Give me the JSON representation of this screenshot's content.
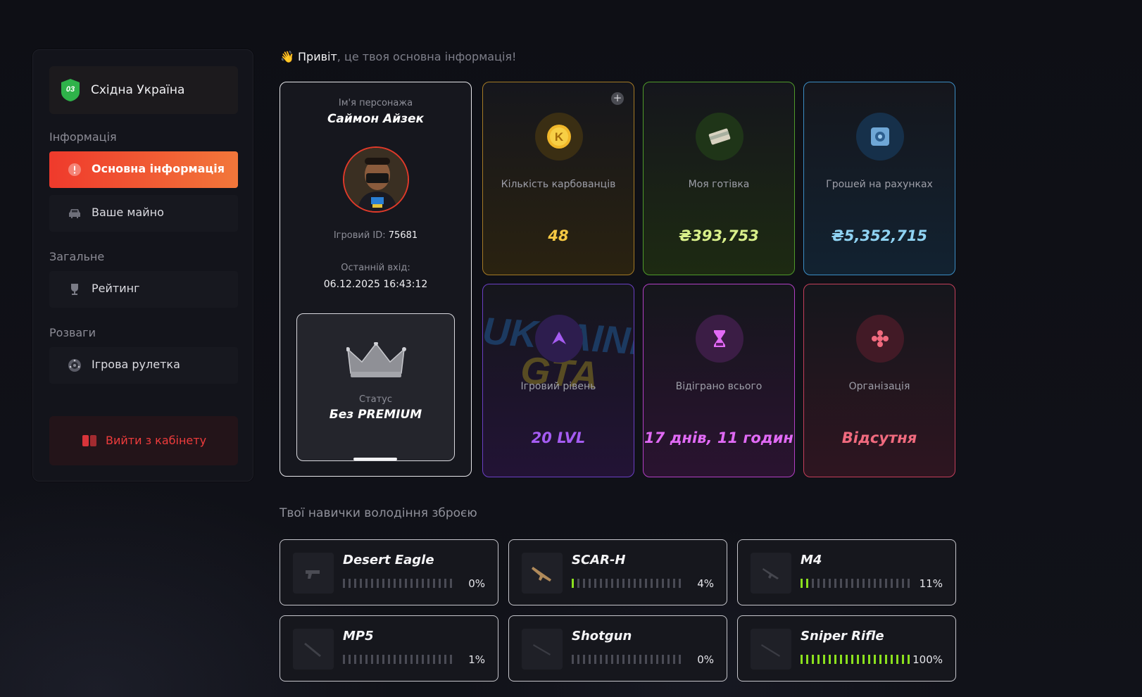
{
  "colors": {
    "accent_orange": "#f2773a",
    "accent_red": "#ef3a2c",
    "karbovantsi": "#f5c843",
    "cash": "#d9f08a",
    "accounts": "#8fd3f3",
    "level": "#a55cf2",
    "played": "#e16af5",
    "org": "#f06a7e",
    "skill_on": "#8be01e"
  },
  "sidebar": {
    "server": {
      "badge": "03",
      "name": "Східна Україна"
    },
    "sections": [
      {
        "label": "Інформація"
      },
      {
        "label": "Загальне"
      },
      {
        "label": "Розваги"
      }
    ],
    "items": [
      {
        "label": "Основна інформація",
        "icon": "alert-icon",
        "active": true
      },
      {
        "label": "Ваше майно",
        "icon": "car-icon"
      },
      {
        "label": "Рейтинг",
        "icon": "trophy-icon"
      },
      {
        "label": "Ігрова рулетка",
        "icon": "roulette-icon"
      }
    ],
    "logout_label": "Вийти з кабінету"
  },
  "greeting": {
    "emoji": "👋",
    "hi": "Привіт",
    "rest": ", це твоя основна інформація!"
  },
  "profile": {
    "name_caption": "Ім'я персонажа",
    "name": "Саймон Айзек",
    "id_caption": "Ігровий ID:",
    "id": "75681",
    "last_login_caption": "Останній вхід:",
    "last_login": "06.12.2025 16:43:12",
    "status_caption": "Статус",
    "status": "Без PREMIUM"
  },
  "stats": [
    {
      "label": "Кількість карбованців",
      "value": "48",
      "icon": "coin-icon"
    },
    {
      "label": "Моя готівка",
      "value": "₴393,753",
      "icon": "cash-icon"
    },
    {
      "label": "Грошей на рахунках",
      "value": "₴5,352,715",
      "icon": "safe-icon"
    },
    {
      "label": "Ігровий рівень",
      "value": "20 LVL",
      "icon": "level-icon"
    },
    {
      "label": "Відіграно всього",
      "value": "17 днів, 11 годин",
      "icon": "hourglass-icon"
    },
    {
      "label": "Організація",
      "value": "Відсутня",
      "icon": "group-icon"
    }
  ],
  "skills_title": "Твої навички володіння зброєю",
  "skills": [
    {
      "name": "Desert Eagle",
      "percent": 0,
      "pct_label": "0%"
    },
    {
      "name": "SCAR-H",
      "percent": 4,
      "pct_label": "4%"
    },
    {
      "name": "M4",
      "percent": 11,
      "pct_label": "11%"
    },
    {
      "name": "MP5",
      "percent": 1,
      "pct_label": "1%"
    },
    {
      "name": "Shotgun",
      "percent": 0,
      "pct_label": "0%"
    },
    {
      "name": "Sniper Rifle",
      "percent": 100,
      "pct_label": "100%"
    }
  ]
}
